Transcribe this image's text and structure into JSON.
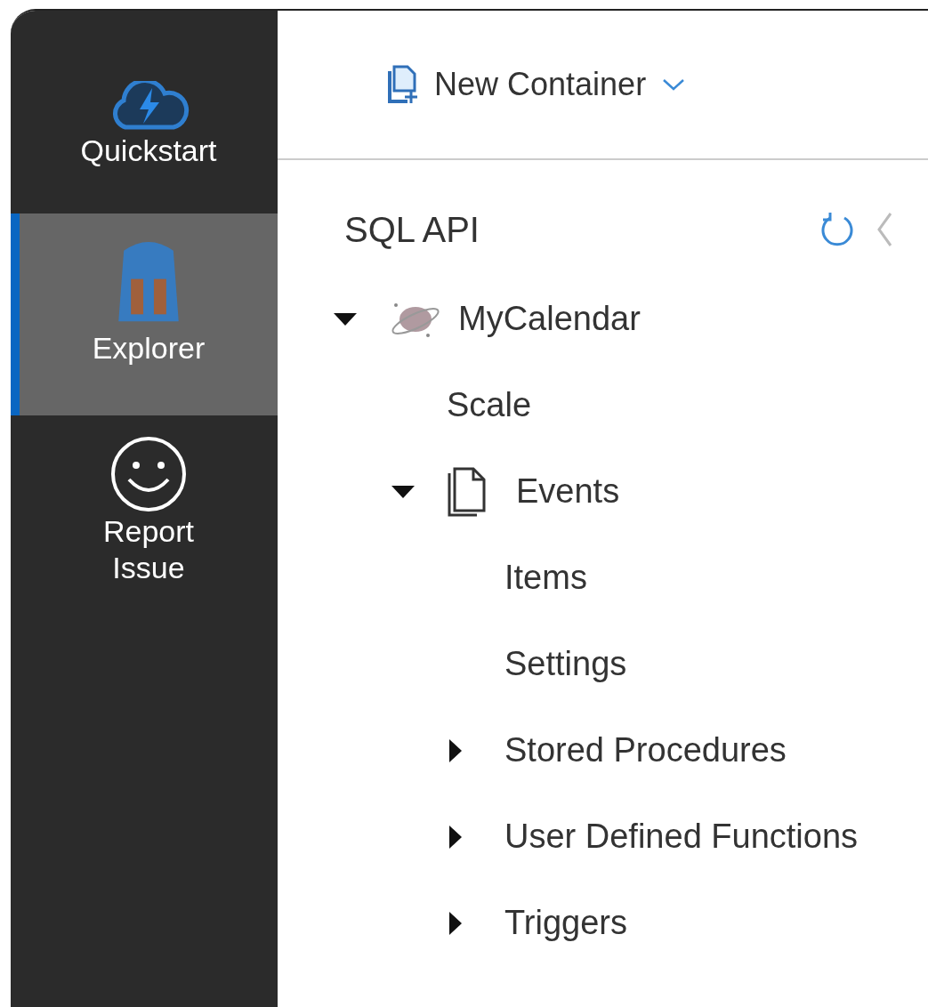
{
  "sidebar": {
    "items": [
      {
        "label": "Quickstart",
        "kind": "cloud",
        "selected": false
      },
      {
        "label": "Explorer",
        "kind": "explorer",
        "selected": true
      },
      {
        "label": "Report Issue",
        "kind": "smiley",
        "selected": false
      }
    ]
  },
  "toolbar": {
    "new_container": {
      "label": "New Container"
    }
  },
  "panel": {
    "title": "SQL API"
  },
  "tree": [
    {
      "label": "MyCalendar",
      "kind": "database",
      "expanded": true,
      "children": [
        {
          "label": "Scale"
        },
        {
          "label": "Events",
          "kind": "container",
          "expanded": true,
          "children": [
            {
              "label": "Items"
            },
            {
              "label": "Settings"
            },
            {
              "label": "Stored Procedures",
              "expanded": false
            },
            {
              "label": "User Defined Functions",
              "expanded": false
            },
            {
              "label": "Triggers",
              "expanded": false
            }
          ]
        }
      ]
    }
  ]
}
